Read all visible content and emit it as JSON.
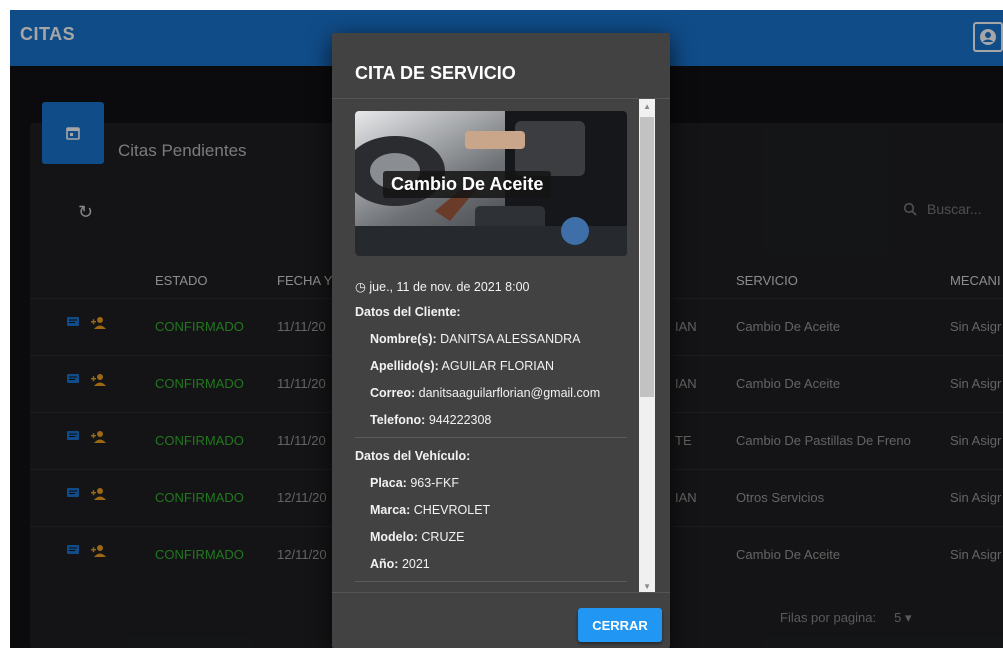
{
  "app": {
    "title": "CITAS"
  },
  "card": {
    "title": "Citas Pendientes"
  },
  "search": {
    "placeholder": "Buscar..."
  },
  "table": {
    "headers": {
      "estado": "ESTADO",
      "fecha": "FECHA Y",
      "servicio": "SERVICIO",
      "mecanico": "MECANI"
    },
    "rows": [
      {
        "estado": "CONFIRMADO",
        "fecha": "11/11/20",
        "cliente": "IAN",
        "servicio": "Cambio De Aceite",
        "mecanico": "Sin Asigr"
      },
      {
        "estado": "CONFIRMADO",
        "fecha": "11/11/20",
        "cliente": "IAN",
        "servicio": "Cambio De Aceite",
        "mecanico": "Sin Asigr"
      },
      {
        "estado": "CONFIRMADO",
        "fecha": "11/11/20",
        "cliente": "TE",
        "servicio": "Cambio De Pastillas De Freno",
        "mecanico": "Sin Asigr"
      },
      {
        "estado": "CONFIRMADO",
        "fecha": "12/11/20",
        "cliente": "IAN",
        "servicio": "Otros Servicios",
        "mecanico": "Sin Asigr"
      },
      {
        "estado": "CONFIRMADO",
        "fecha": "12/11/20",
        "cliente": "",
        "servicio": "Cambio De Aceite",
        "mecanico": "Sin Asigr"
      }
    ]
  },
  "pagination": {
    "label": "Filas por pagina:",
    "value": "5"
  },
  "dialog": {
    "title": "CITA DE SERVICIO",
    "service_name": "Cambio De Aceite",
    "datetime": "jue., 11 de nov. de 2021 8:00",
    "client_section": "Datos del Cliente:",
    "client": [
      {
        "label": "Nombre(s):",
        "value": "DANITSA ALESSANDRA"
      },
      {
        "label": "Apellido(s):",
        "value": "AGUILAR FLORIAN"
      },
      {
        "label": "Correo:",
        "value": "danitsaaguilarflorian@gmail.com"
      },
      {
        "label": "Telefono:",
        "value": "944222308"
      }
    ],
    "vehicle_section": "Datos del Vehículo:",
    "vehicle": [
      {
        "label": "Placa:",
        "value": "963-FKF"
      },
      {
        "label": "Marca:",
        "value": "CHEVROLET"
      },
      {
        "label": "Modelo:",
        "value": "CRUZE"
      },
      {
        "label": "Año:",
        "value": "2021"
      }
    ],
    "close_label": "CERRAR"
  },
  "colors": {
    "primary": "#1976d2",
    "accent": "#2196f3",
    "confirmed": "#33b72e",
    "dialog_bg": "#424242"
  },
  "icons": [
    "user-icon",
    "calendar-icon",
    "refresh-icon",
    "search-icon",
    "comment-icon",
    "add-user-icon",
    "clock-icon",
    "dropdown-icon"
  ]
}
